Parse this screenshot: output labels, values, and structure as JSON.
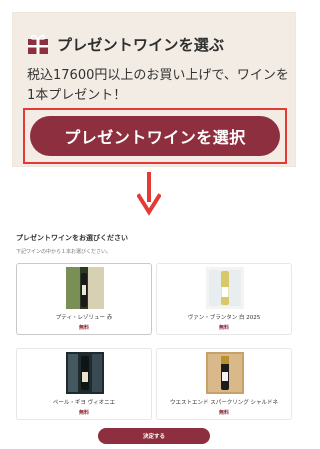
{
  "promo": {
    "title": "プレゼントワインを選ぶ",
    "description": "税込17600円以上のお買い上げで、ワインを1本プレゼント！",
    "cta_label": "プレゼントワインを選択",
    "gift_icon": "gift-icon",
    "arrow_icon": "arrow-down-icon",
    "colors": {
      "panel": "#f3ece4",
      "accent": "#8d2f3e",
      "highlight": "#e53935"
    }
  },
  "selection": {
    "title": "プレゼントワインをお選びください",
    "note": "下記ワインの中から１本お選びください。",
    "items": [
      {
        "name": "プティ・レゾリュー 赤",
        "price": "無料"
      },
      {
        "name": "ヴァン・ブランタン 白 2025",
        "price": "無料"
      },
      {
        "name": "ペール・ギヨ ヴィオニエ",
        "price": "無料"
      },
      {
        "name": "ウエストエンド スパークリング シャルドネ",
        "price": "無料"
      }
    ],
    "decide_label": "決定する"
  }
}
